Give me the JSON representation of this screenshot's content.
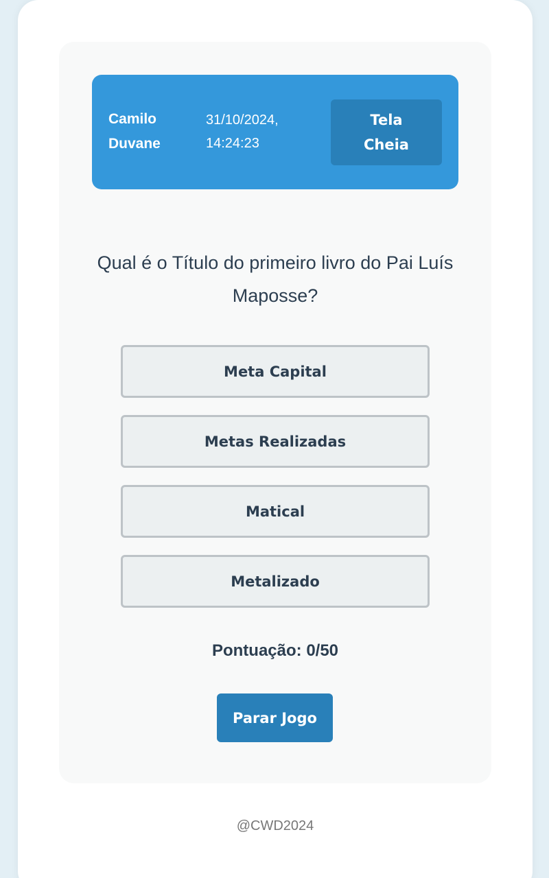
{
  "header": {
    "user_name": "Camilo Duvane",
    "datetime": "31/10/2024, 14:24:23",
    "fullscreen_label": "Tela Cheia"
  },
  "quiz": {
    "question": "Qual é o Título do primeiro livro do Pai Luís Maposse?",
    "options": [
      "Meta Capital",
      "Metas Realizadas",
      "Matical",
      "Metalizado"
    ],
    "score_text": "Pontuação: 0/50",
    "stop_label": "Parar Jogo"
  },
  "footer": {
    "text": "@CWD2024"
  },
  "colors": {
    "header": "#3498db",
    "button": "#2980b9",
    "text": "#2c3e50"
  }
}
